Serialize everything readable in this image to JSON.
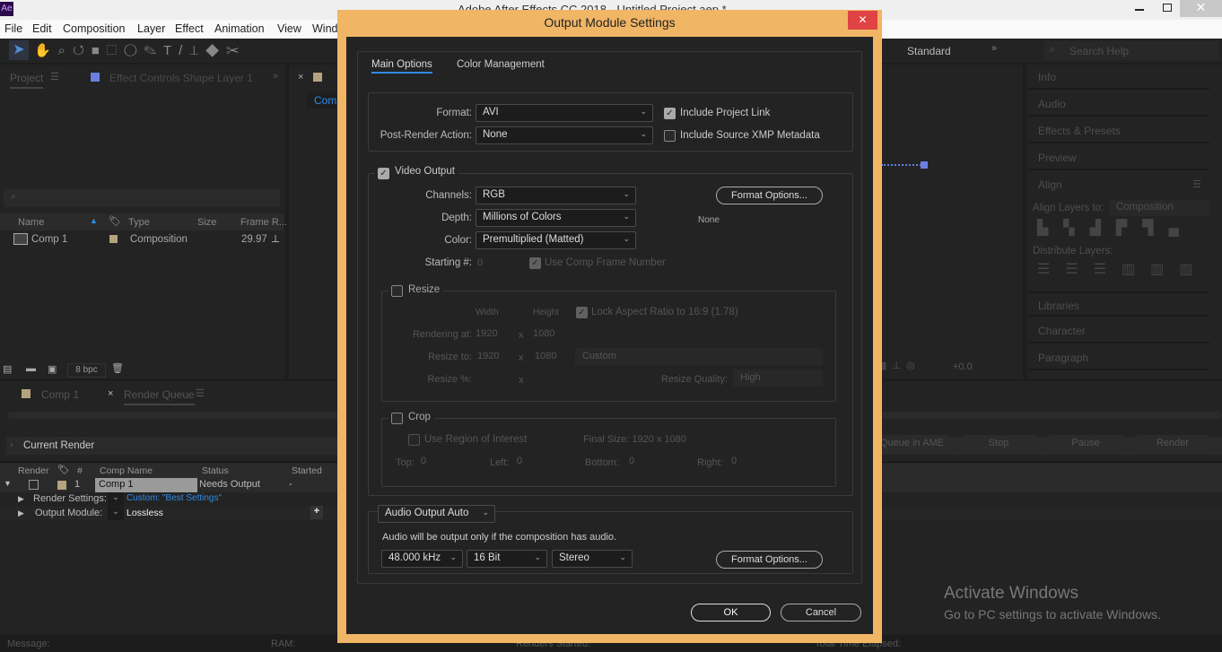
{
  "app": {
    "icon": "Ae",
    "title": "Adobe After Effects CC 2018 - Untitled Project.aep *"
  },
  "menu": [
    "File",
    "Edit",
    "Composition",
    "Layer",
    "Effect",
    "Animation",
    "View",
    "Wind"
  ],
  "workspace": {
    "label": "Standard",
    "search_placeholder": "Search Help"
  },
  "project_panel": {
    "tab": "Project",
    "effect_tab": "Effect Controls Shape Layer 1",
    "columns": [
      "Name",
      "Type",
      "Size",
      "Frame R..."
    ],
    "items": [
      {
        "name": "Comp 1",
        "type": "Composition",
        "frame_rate": "29.97"
      }
    ],
    "bpc": "8 bpc"
  },
  "comp_panel": {
    "tab": "Comp",
    "exposure": "+0.0"
  },
  "right_panels": [
    "Info",
    "Audio",
    "Effects & Presets",
    "Preview",
    "Align",
    "Libraries",
    "Character",
    "Paragraph"
  ],
  "align": {
    "align_to_label": "Align Layers to:",
    "align_to_value": "Composition",
    "distribute_label": "Distribute Layers:"
  },
  "bottom_tabs": {
    "comp": "Comp 1",
    "render_queue": "Render Queue"
  },
  "render_queue": {
    "current_render": "Current Render",
    "buttons": [
      "Queue in AME",
      "Stop",
      "Pause",
      "Render"
    ],
    "columns": [
      "Render",
      "#",
      "Comp Name",
      "Status",
      "Started"
    ],
    "item": {
      "num": "1",
      "comp": "Comp 1",
      "status": "Needs Output",
      "started": "-"
    },
    "render_settings_label": "Render Settings:",
    "render_settings_value": "Custom: \"Best Settings\"",
    "output_module_label": "Output Module:",
    "output_module_value": "Lossless"
  },
  "status_bar": {
    "message": "Message:",
    "ram": "RAM:",
    "renders_started": "Renders Started:",
    "elapsed": "Total Time Elapsed:"
  },
  "watermark": {
    "title": "Activate Windows",
    "sub": "Go to PC settings to activate Windows."
  },
  "dialog": {
    "title": "Output Module Settings",
    "close": "✕",
    "tabs": [
      "Main Options",
      "Color Management"
    ],
    "format_label": "Format:",
    "format": "AVI",
    "post_label": "Post-Render Action:",
    "post": "None",
    "include_project_link": "Include Project Link",
    "include_project_link_checked": true,
    "include_xmp": "Include Source XMP Metadata",
    "include_xmp_checked": false,
    "video_output": "Video Output",
    "video_output_checked": true,
    "channels_label": "Channels:",
    "channels": "RGB",
    "depth_label": "Depth:",
    "depth": "Millions of Colors",
    "color_label": "Color:",
    "color": "Premultiplied (Matted)",
    "starting_label": "Starting #:",
    "starting": "0",
    "use_comp_frame": "Use Comp Frame Number",
    "format_options": "Format Options...",
    "codec_info": "None",
    "resize": "Resize",
    "resize_checked": false,
    "width_h": "Width",
    "height_h": "Height",
    "lock_aspect": "Lock Aspect Ratio to 16:9 (1.78)",
    "rendering_at_label": "Rendering at:",
    "rendering_w": "1920",
    "rendering_h": "1080",
    "resize_to_label": "Resize to:",
    "resize_w": "1920",
    "resize_h": "1080",
    "resize_preset": "Custom",
    "resize_pct_label": "Resize %:",
    "x": "x",
    "quality_label": "Resize Quality:",
    "quality": "High",
    "crop": "Crop",
    "crop_checked": false,
    "roi": "Use Region of Interest",
    "final_size": "Final Size: 1920 x 1080",
    "top_label": "Top:",
    "top": "0",
    "left_label": "Left:",
    "left": "0",
    "bottom_label": "Bottom:",
    "bottom": "0",
    "right_label": "Right:",
    "right": "0",
    "audio_mode": "Audio Output Auto",
    "audio_note": "Audio will be output only if the composition has audio.",
    "sample_rate": "48.000 kHz",
    "bit_depth": "16 Bit",
    "channels_audio": "Stereo",
    "audio_format_options": "Format Options...",
    "ok": "OK",
    "cancel": "Cancel"
  },
  "colors": {
    "accent": "#2d8ceb",
    "dialog_border": "#f0b565",
    "close_red": "#e04343",
    "label_swatch": "#b5a380",
    "layer_blue": "#6b7fe0"
  }
}
